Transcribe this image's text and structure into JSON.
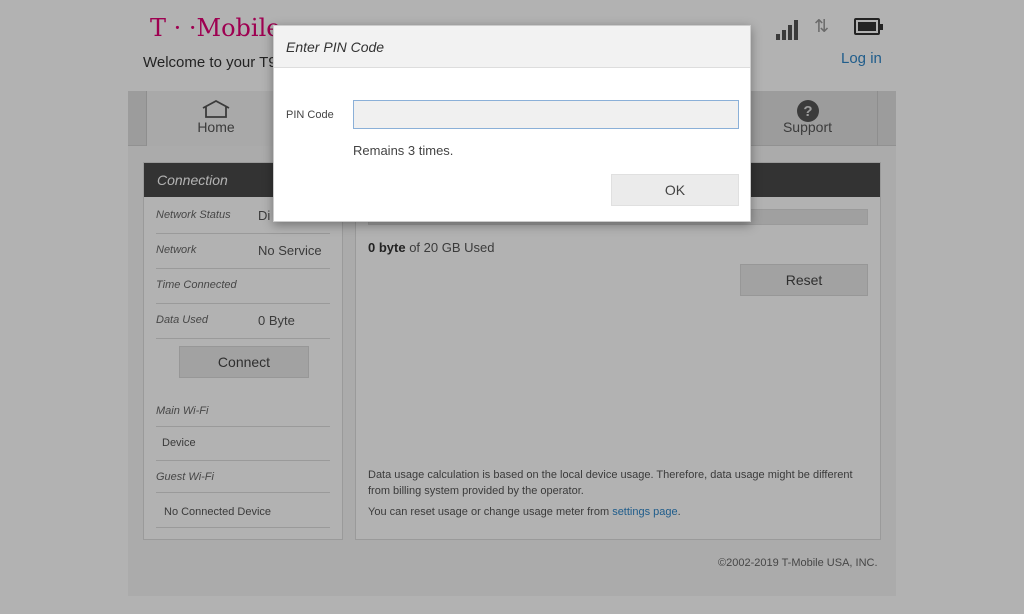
{
  "header": {
    "brand": "T · ·Mobile·",
    "welcome": "Welcome to your T9",
    "login_label": "Log in",
    "signal_icon": "signal-bars-icon",
    "data_icon": "data-arrows-icon",
    "battery_icon": "battery-icon"
  },
  "nav": {
    "items": [
      {
        "label": "Home",
        "icon": "home-icon"
      },
      {
        "label": "Support",
        "icon": "help-circle-icon"
      }
    ]
  },
  "connection": {
    "title": "Connection",
    "rows": [
      {
        "label": "Network Status",
        "value": "Di"
      },
      {
        "label": "Network",
        "value": "No Service"
      },
      {
        "label": "Time Connected",
        "value": ""
      },
      {
        "label": "Data Used",
        "value": "0 Byte"
      }
    ],
    "connect_label": "Connect",
    "main_wifi_label": "Main Wi-Fi",
    "device_label": "Device",
    "guest_wifi_label": "Guest Wi-Fi",
    "no_device_label": "No Connected Device"
  },
  "usage": {
    "used_amount": "0 byte",
    "used_suffix": " of 20 GB Used",
    "used_fraction": 0,
    "reset_label": "Reset",
    "note": "Data usage calculation is based on the local device usage. Therefore, data usage might be different from billing system provided by the operator.",
    "note2_prefix": "You can reset usage or change usage meter from ",
    "note2_link": "settings page",
    "note2_suffix": "."
  },
  "footer": {
    "copyright": "©2002-2019 T-Mobile USA, INC."
  },
  "dialog": {
    "title": "Enter PIN Code",
    "pin_label": "PIN Code",
    "pin_value": "",
    "pin_placeholder": "",
    "remains": "Remains 3 times.",
    "ok_label": "OK"
  },
  "colors": {
    "brand": "#e20074",
    "link": "#2f86c8",
    "panel_header": "#4a4a4a"
  }
}
